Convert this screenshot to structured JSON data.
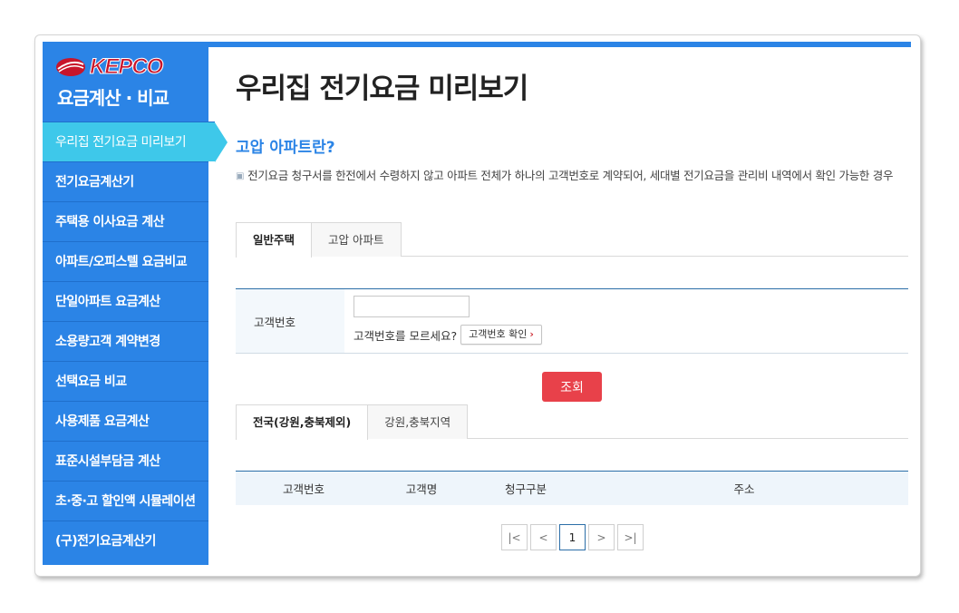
{
  "sidebar": {
    "logo_text": "KEPCO",
    "title": "요금계산 · 비교",
    "items": [
      {
        "label": "우리집 전기요금 미리보기",
        "active": true
      },
      {
        "label": "전기요금계산기"
      },
      {
        "label": "주택용 이사요금 계산"
      },
      {
        "label": "아파트/오피스텔 요금비교"
      },
      {
        "label": "단일아파트 요금계산"
      },
      {
        "label": "소용량고객 계약변경"
      },
      {
        "label": "선택요금 비교"
      },
      {
        "label": "사용제품 요금계산"
      },
      {
        "label": "표준시설부담금 계산"
      },
      {
        "label": "초·중·고 할인액 시뮬레이션"
      },
      {
        "label": "(구)전기요금계산기"
      }
    ]
  },
  "main": {
    "page_title": "우리집 전기요금 미리보기",
    "section_title": "고압 아파트란?",
    "description": "전기요금 청구서를 한전에서 수령하지 않고 아파트 전체가 하나의 고객번호로 계약되어, 세대별 전기요금을 관리비 내역에서 확인 가능한 경우",
    "tabs": [
      {
        "label": "일반주택",
        "active": true
      },
      {
        "label": "고압 아파트"
      }
    ],
    "form": {
      "label": "고객번호",
      "input_value": "",
      "hint": "고객번호를 모르세요?",
      "check_button": "고객번호 확인"
    },
    "search_button": "조회",
    "region_tabs": [
      {
        "label": "전국(강원,충북제외)",
        "active": true
      },
      {
        "label": "강원,충북지역"
      }
    ],
    "result_table": {
      "columns": [
        "고객번호",
        "고객명",
        "청구구분",
        "주소"
      ]
    },
    "pagination": {
      "first": "|<",
      "prev": "<",
      "current": "1",
      "next": ">",
      "last": ">|"
    }
  },
  "colors": {
    "sidebar_bg": "#2b84e6",
    "active_item": "#3ec8ea",
    "accent_blue": "#2b84e6",
    "search_button": "#e8414a"
  }
}
